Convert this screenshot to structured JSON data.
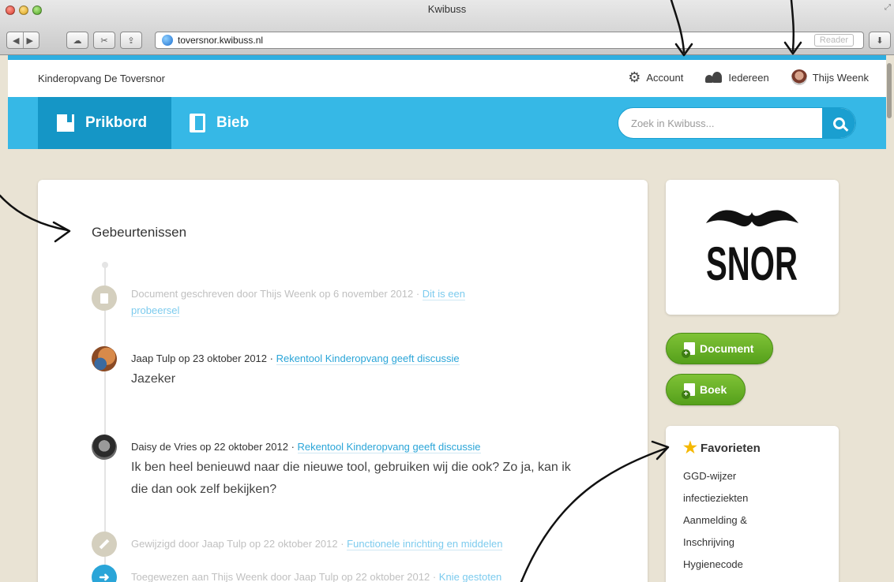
{
  "window": {
    "title": "Kwibuss",
    "url": "toversnor.kwibuss.nl",
    "reader_label": "Reader"
  },
  "site": {
    "org_name": "Kinderopvang De Toversnor",
    "top_nav": {
      "account": "Account",
      "everyone": "Iedereen",
      "user": "Thijs Weenk"
    },
    "tabs": [
      {
        "label": "Prikbord",
        "active": true
      },
      {
        "label": "Bieb",
        "active": false
      }
    ],
    "search": {
      "placeholder": "Zoek in Kwibuss..."
    }
  },
  "main": {
    "title": "Gebeurtenissen",
    "events": [
      {
        "meta": "Document geschreven door Thijs Weenk op 6 november 2012 · ",
        "link": "Dit is een probeersel",
        "faded": true,
        "message": ""
      },
      {
        "meta": "Jaap Tulp op 23 oktober 2012 · ",
        "link": "Rekentool Kinderopvang geeft discussie",
        "faded": false,
        "message": "Jazeker"
      },
      {
        "meta": "Daisy de Vries op 22 oktober 2012 · ",
        "link": "Rekentool Kinderopvang geeft discussie",
        "faded": false,
        "message": "Ik ben heel benieuwd naar die nieuwe tool, gebruiken wij die ook? Zo ja, kan ik die dan ook zelf bekijken?"
      },
      {
        "meta": "Gewijzigd door Jaap Tulp op 22 oktober 2012 · ",
        "link": "Functionele inrichting en middelen",
        "faded": true,
        "message": ""
      },
      {
        "meta": "Toegewezen aan Thijs Weenk door Jaap Tulp op 22 oktober 2012 · ",
        "link": "Knie gestoten",
        "faded": true,
        "message": ""
      }
    ]
  },
  "sidebar": {
    "logo_text": "SNOR",
    "buttons": {
      "document": "Document",
      "boek": "Boek"
    },
    "favorites": {
      "title": "Favorieten",
      "items": [
        "GGD-wijzer",
        "infectieziekten",
        "Aanmelding &",
        "Inschrijving",
        "Hygienecode"
      ]
    }
  },
  "colors": {
    "accent_blue": "#36b8e6",
    "active_tab": "#1596c6",
    "green": "#6ab12a",
    "background": "#e9e3d4"
  }
}
